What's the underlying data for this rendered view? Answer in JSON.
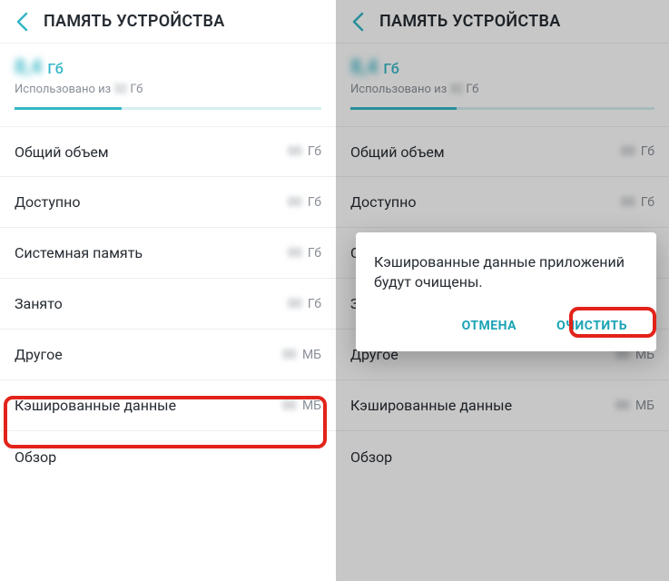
{
  "header": {
    "title": "ПАМЯТЬ УСТРОЙСТВА"
  },
  "summary": {
    "used_amount": "8,4",
    "used_unit": "Гб",
    "sub_prefix": "Использовано из",
    "sub_total": "32",
    "sub_unit": "Гб"
  },
  "rows": [
    {
      "label": "Общий объем",
      "unit": "Гб"
    },
    {
      "label": "Доступно",
      "unit": "Гб"
    },
    {
      "label": "Системная память",
      "unit": "Гб"
    },
    {
      "label": "Занято",
      "unit": "Гб"
    },
    {
      "label": "Другое",
      "unit": "МБ"
    },
    {
      "label": "Кэшированные данные",
      "unit": "МБ"
    }
  ],
  "section": {
    "label": "Обзор"
  },
  "dialog": {
    "text": "Кэшированные данные приложений будут очищены.",
    "cancel": "ОТМЕНА",
    "confirm": "ОЧИСТИТЬ"
  }
}
